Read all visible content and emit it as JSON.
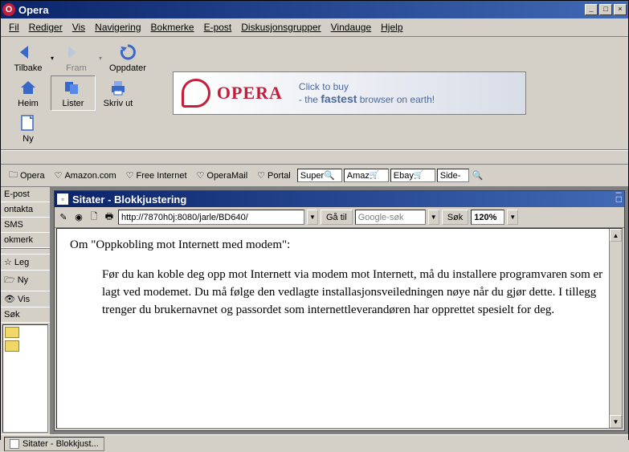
{
  "window": {
    "title": "Opera",
    "min": "_",
    "max": "□",
    "close": "×"
  },
  "menu": [
    "Fil",
    "Rediger",
    "Vis",
    "Navigering",
    "Bokmerke",
    "E-post",
    "Diskusjonsgrupper",
    "Vindauge",
    "Hjelp"
  ],
  "toolbar": {
    "back": "Tilbake",
    "forward": "Fram",
    "reload": "Oppdater",
    "home": "Heim",
    "lists": "Lister",
    "print": "Skriv ut",
    "new": "Ny"
  },
  "banner": {
    "brand": "OPERA",
    "line1": "Click to buy",
    "line2a": "- the ",
    "line2b": "fastest",
    "line2c": " browser on earth!"
  },
  "bookmarks": {
    "items": [
      "Opera",
      "Amazon.com",
      "Free Internet",
      "OperaMail",
      "Portal"
    ],
    "searches": [
      "Super",
      "Amaz",
      "Ebay",
      "Side-"
    ]
  },
  "sidebar": {
    "items": [
      "E-post",
      "ontakta",
      "SMS",
      "okmerk"
    ],
    "items2": [
      "☆ Leg",
      "🗁 Ny",
      "👁 Vis",
      "Søk"
    ]
  },
  "doc": {
    "title": "Sitater - Blokkjustering",
    "url": "http://7870h0j:8080/jarle/BD640/",
    "go": "Gå til",
    "searchhint": "Google-søk",
    "search": "Søk",
    "zoom": "120%",
    "heading": "Om \"Oppkobling mot Internett med modem\":",
    "body": "Før du kan koble deg opp mot Internett via modem mot Internett, må du installere programvaren som er lagt ved modemet. Du må følge den vedlagte installasjonsveiledningen nøye når du gjør dette. I tillegg trenger du brukernavnet og passordet som internettleverandøren har opprettet spesielt for deg."
  },
  "taskbar": {
    "tab": "Sitater - Blokkjust..."
  }
}
